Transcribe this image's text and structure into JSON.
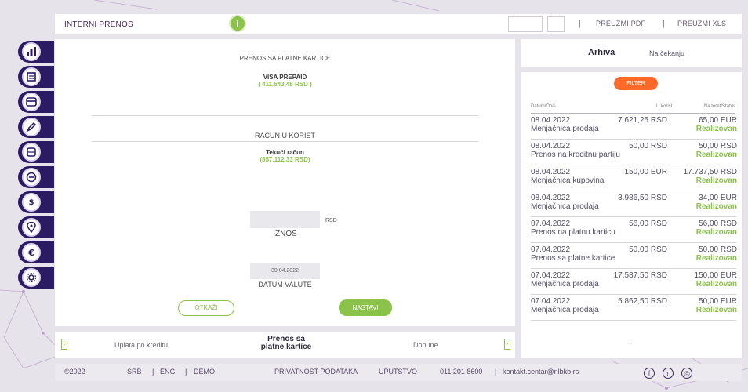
{
  "header": {
    "title": "INTERNI PRENOS",
    "info_icon": "info-icon",
    "sep1": "|",
    "sep2": "|",
    "pdf_label": "PREUZMI PDF",
    "xls_label": "PREUZMI XLS"
  },
  "sidebar": {
    "items": [
      {
        "icon": "bar-chart-icon"
      },
      {
        "icon": "document-icon"
      },
      {
        "icon": "card-icon"
      },
      {
        "icon": "edit-icon"
      },
      {
        "icon": "transfer-icon"
      },
      {
        "icon": "minus-icon"
      },
      {
        "icon": "dollar-icon"
      },
      {
        "icon": "location-icon"
      },
      {
        "icon": "euro-icon"
      },
      {
        "icon": "settings-icon"
      }
    ]
  },
  "form": {
    "heading": "PRENOS SA PLATNE KARTICE",
    "source_name": "VISA PREPAID",
    "source_balance": "( 411.643,48 RSD )",
    "target_heading": "RAČUN U KORIST",
    "target_name": "Tekući račun",
    "target_balance": "(857.112,33 RSD)",
    "amount_currency": "RSD",
    "amount_label": "IZNOS",
    "date_value": "30.04.2022",
    "date_label": "DATUM VALUTE",
    "cancel_label": "OTKAŽI",
    "next_label": "NASTAVI"
  },
  "carousel": {
    "left_arrow": "‹",
    "right_arrow": "›",
    "prev_label": "Uplata po kreditu",
    "current_label_line1": "Prenos sa",
    "current_label_line2": "platne kartice",
    "next_label": "Dopune"
  },
  "archive": {
    "tab_archive": "Arhiva",
    "tab_pending": "Na čekanju"
  },
  "list": {
    "filter_label": "FILTER",
    "col_date": "Datum/Opis",
    "col_credit": "U korist",
    "col_debit": "Na teret/Status",
    "rows": [
      {
        "date": "08.04.2022",
        "credit": "7.621,25 RSD",
        "debit": "65,00 EUR",
        "desc": "Menjačnica prodaja",
        "status": "Realizovan"
      },
      {
        "date": "08.04.2022",
        "credit": "50,00 RSD",
        "debit": "50,00 RSD",
        "desc": "Prenos na kreditnu partiju",
        "status": "Realizovan"
      },
      {
        "date": "08.04.2022",
        "credit": "150,00 EUR",
        "debit": "17.737,50 RSD",
        "desc": "Menjačnica kupovina",
        "status": "Realizovan"
      },
      {
        "date": "08.04.2022",
        "credit": "3.986,50 RSD",
        "debit": "34,00 EUR",
        "desc": "Menjačnica prodaja",
        "status": "Realizovan"
      },
      {
        "date": "07.04.2022",
        "credit": "56,00 RSD",
        "debit": "56,00 RSD",
        "desc": "Prenos na platnu karticu",
        "status": "Realizovan"
      },
      {
        "date": "07.04.2022",
        "credit": "50,00 RSD",
        "debit": "50,00 RSD",
        "desc": "Prenos sa platne kartice",
        "status": "Realizovan"
      },
      {
        "date": "07.04.2022",
        "credit": "17.587,50 RSD",
        "debit": "150,00 EUR",
        "desc": "Menjačnica prodaja",
        "status": "Realizovan"
      },
      {
        "date": "07.04.2022",
        "credit": "5.862,50 RSD",
        "debit": "50,00 EUR",
        "desc": "Menjačnica prodaja",
        "status": "Realizovan"
      }
    ]
  },
  "footer": {
    "copyright": "©2022",
    "lang_srb": "SRB",
    "lang_eng": "ENG",
    "demo": "DEMO",
    "sep": "|",
    "privacy": "PRIVATNOST PODATAKA",
    "guide": "UPUTSTVO",
    "phone": "011 201 8600",
    "email": "kontakt.centar@nlbkb.rs",
    "facebook": "f",
    "linkedin": "in",
    "instagram": "◎"
  },
  "colors": {
    "brand_dark": "#2a1b63",
    "accent_green": "#8bc34a",
    "accent_orange": "#ff6a2a"
  }
}
